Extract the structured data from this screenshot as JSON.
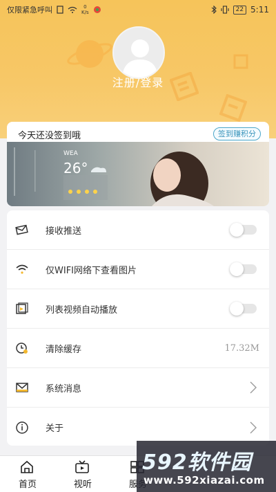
{
  "status_bar": {
    "carrier": "仅限紧急呼叫",
    "net_speed_value": "0",
    "net_speed_unit": "K/s",
    "battery": "22",
    "time": "5:11"
  },
  "profile": {
    "login_text": "注册/登录"
  },
  "signin": {
    "title": "今天还没签到哦",
    "button_label": "签到赚积分",
    "banner": {
      "temperature": "26°",
      "city": "WEA"
    }
  },
  "settings": {
    "items": [
      {
        "label": "接收推送",
        "icon": "mail-icon",
        "control": "toggle",
        "on": false
      },
      {
        "label": "仅WIFI网络下查看图片",
        "icon": "wifi-icon",
        "control": "toggle",
        "on": false
      },
      {
        "label": "列表视频自动播放",
        "icon": "video-icon",
        "control": "toggle",
        "on": false
      },
      {
        "label": "清除缓存",
        "icon": "clock-icon",
        "control": "value",
        "value": "17.32M"
      },
      {
        "label": "系统消息",
        "icon": "envelope-icon",
        "control": "chevron"
      },
      {
        "label": "关于",
        "icon": "info-icon",
        "control": "chevron"
      }
    ]
  },
  "tabbar": {
    "tabs": [
      {
        "label": "首页",
        "icon": "home-icon"
      },
      {
        "label": "视听",
        "icon": "tv-icon"
      },
      {
        "label": "服务",
        "icon": "service-icon"
      }
    ]
  },
  "watermark": {
    "main": "592软件园",
    "sub": "www.592xiazai.com"
  },
  "colors": {
    "header": "#f7c766",
    "accent_outline": "#4aa6c9",
    "toggle_off": "#e6e6e6"
  }
}
